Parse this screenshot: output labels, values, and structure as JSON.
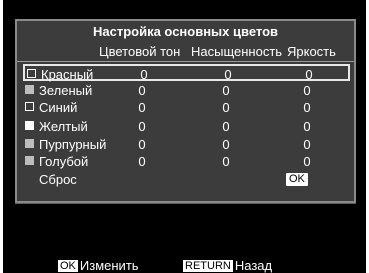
{
  "title": "Настройка основных цветов",
  "headers": {
    "hue": "Цветовой тон",
    "saturation": "Насыщенность",
    "brightness": "Яркость"
  },
  "rows": [
    {
      "label": "Красный",
      "hue": "0",
      "saturation": "0",
      "brightness": "0",
      "selected": true,
      "swatch": "outline"
    },
    {
      "label": "Зеленый",
      "hue": "0",
      "saturation": "0",
      "brightness": "0",
      "swatch": "gray"
    },
    {
      "label": "Синий",
      "hue": "0",
      "saturation": "0",
      "brightness": "0",
      "swatch": "outline"
    },
    {
      "label": "Желтый",
      "hue": "0",
      "saturation": "0",
      "brightness": "0",
      "swatch": "filled"
    },
    {
      "label": "Пурпурный",
      "hue": "0",
      "saturation": "0",
      "brightness": "0",
      "swatch": "gray"
    },
    {
      "label": "Голубой",
      "hue": "0",
      "saturation": "0",
      "brightness": "0",
      "swatch": "gray"
    }
  ],
  "reset": {
    "label": "Сброс",
    "ok": "OK"
  },
  "footer": {
    "ok_key": "OK",
    "ok_label": "Изменить",
    "return_key": "RETURN",
    "return_label": "Назад"
  },
  "colors": {
    "background": "#000000",
    "panel": "#3c3c3c",
    "text": "#ffffff",
    "border": "#8a8a8a"
  }
}
